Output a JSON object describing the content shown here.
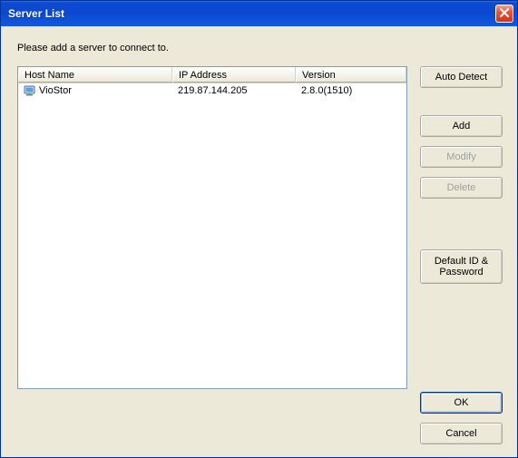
{
  "window": {
    "title": "Server List"
  },
  "instruction": "Please add a server to connect to.",
  "columns": {
    "host": "Host Name",
    "ip": "IP Address",
    "version": "Version"
  },
  "servers": [
    {
      "host": "VioStor",
      "ip": "219.87.144.205",
      "version": "2.8.0(1510)"
    }
  ],
  "buttons": {
    "auto_detect": "Auto Detect",
    "add": "Add",
    "modify": "Modify",
    "delete": "Delete",
    "default_id_pw": "Default ID &\nPassword",
    "ok": "OK",
    "cancel": "Cancel"
  }
}
